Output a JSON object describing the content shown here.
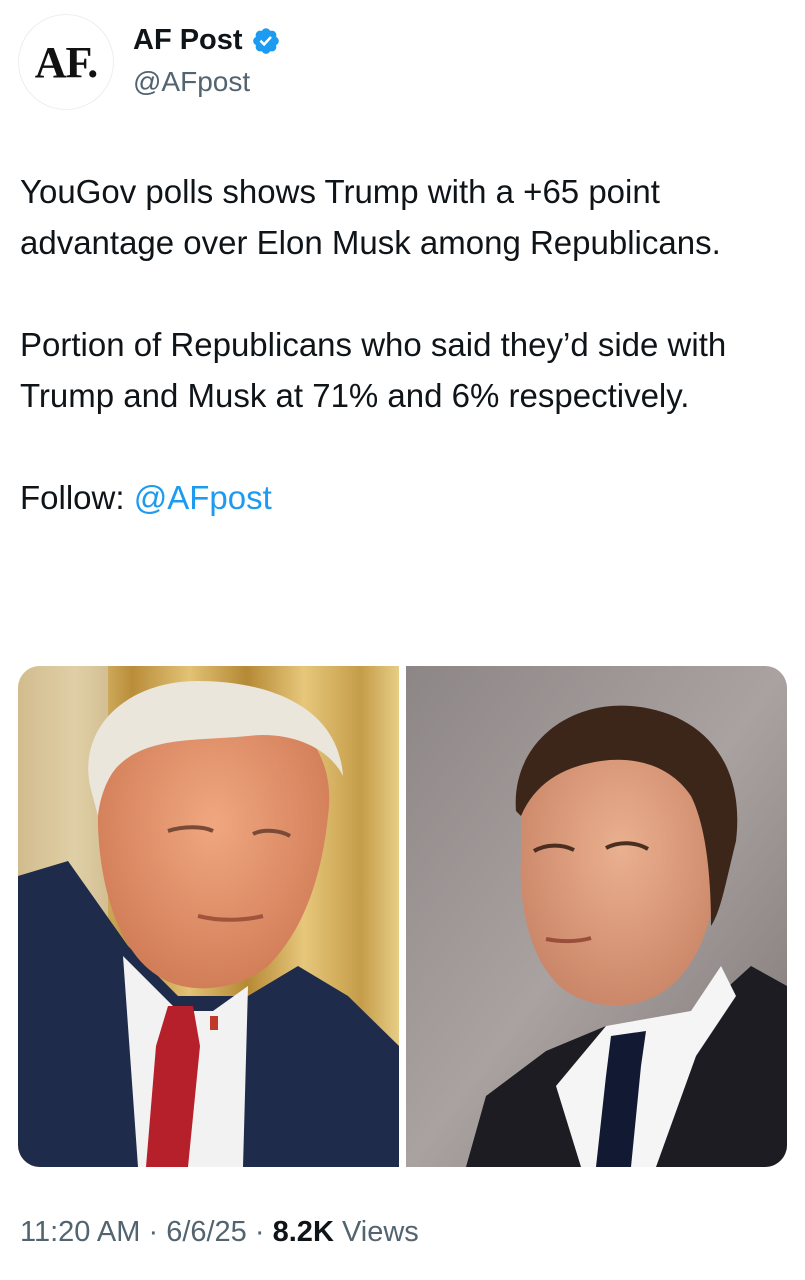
{
  "author": {
    "avatar_text": "AF.",
    "display_name": "AF Post",
    "handle": "@AFpost",
    "verified": true
  },
  "tweet": {
    "paragraph_1": "YouGov polls shows Trump with a +65 point advantage over Elon Musk among Republicans.",
    "paragraph_2": "Portion of Republicans who said they’d side with Trump and Musk at 71% and 6% respectively.",
    "follow_label": "Follow: ",
    "follow_mention": "@AFpost"
  },
  "media": {
    "photos": [
      {
        "subject": "portrait-photo-left"
      },
      {
        "subject": "portrait-photo-right"
      }
    ]
  },
  "meta": {
    "time": "11:20 AM",
    "separator": "·",
    "date": "6/6/25",
    "views_count": "8.2K",
    "views_label": "Views"
  },
  "colors": {
    "accent": "#1d9bf0",
    "text": "#0f1419",
    "secondary": "#536471"
  }
}
